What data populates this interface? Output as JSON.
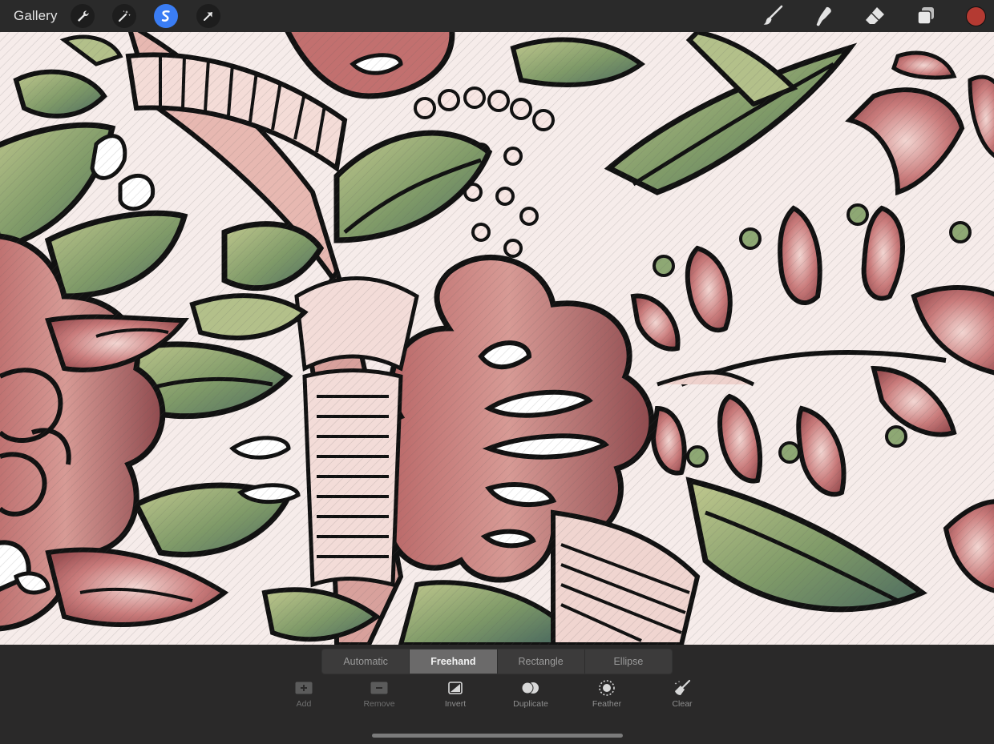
{
  "toolbar": {
    "gallery_label": "Gallery",
    "left_tools": [
      "wrench-icon",
      "magic-wand-icon",
      "selection-icon",
      "transform-arrow-icon"
    ],
    "active_tool": "selection-icon",
    "right_tools": [
      "brush-icon",
      "smudge-icon",
      "eraser-icon",
      "layers-icon"
    ],
    "current_color": "#b43a32"
  },
  "selection_modes": {
    "items": [
      "Automatic",
      "Freehand",
      "Rectangle",
      "Ellipse"
    ],
    "active": "Freehand"
  },
  "selection_actions": [
    {
      "label": "Add",
      "icon": "add-icon"
    },
    {
      "label": "Remove",
      "icon": "remove-icon"
    },
    {
      "label": "Invert",
      "icon": "invert-icon"
    },
    {
      "label": "Duplicate",
      "icon": "duplicate-icon"
    },
    {
      "label": "Feather",
      "icon": "feather-icon"
    },
    {
      "label": "Clear",
      "icon": "clear-broom-icon"
    }
  ],
  "canvas": {
    "artwork": "floral-doodle-pattern",
    "palette": {
      "pink": "#c97b7b",
      "rose": "#a65757",
      "blush": "#efd2cd",
      "leaf": "#7e9a67",
      "olive": "#b3c08a",
      "teal": "#4f6a5c",
      "ink": "#111111",
      "paper": "#f6ecea"
    }
  }
}
